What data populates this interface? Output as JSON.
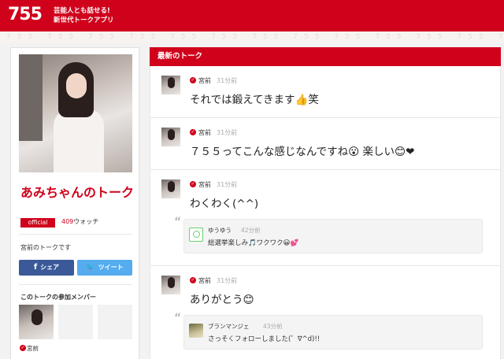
{
  "header": {
    "logo": "755",
    "tagline_line1": "芸能人とも話せる!",
    "tagline_line2": "新世代トークアプリ",
    "brand_color": "#d0021b"
  },
  "sidebar": {
    "talk_title": "あみちゃんのトーク",
    "official_badge": "official",
    "watch_count": "409",
    "watch_label": "ウォッチ",
    "description": "宮前のトークです",
    "share_button": "シェア",
    "tweet_button": "ツイート",
    "members_title": "このトークの参加メンバー",
    "members": [
      {
        "name": "宮前"
      }
    ]
  },
  "feed": {
    "title": "最新のトーク",
    "posts": [
      {
        "author": "宮前",
        "time": "31分前",
        "message": "それでは鍛えてきます👍笑"
      },
      {
        "author": "宮前",
        "time": "31分前",
        "message": "７５５ってこんな感じなんですね😮 楽しい😊❤"
      },
      {
        "author": "宮前",
        "time": "31分前",
        "message": "わくわく(^^)",
        "reply": {
          "author": "ゆうゆう",
          "time": "42分前",
          "text": "総選挙楽しみ🎵ワクワク😀💕"
        }
      },
      {
        "author": "宮前",
        "time": "31分前",
        "message": "ありがとう😊",
        "reply": {
          "author": "ブランマンジェ",
          "time": "43分前",
          "text": "さっそくフォローしました(゜∇^d)!!"
        }
      }
    ]
  },
  "icons": {
    "facebook": "facebook-icon",
    "twitter": "twitter-icon",
    "verified": "verified-check-icon",
    "quote": "quote-icon"
  }
}
